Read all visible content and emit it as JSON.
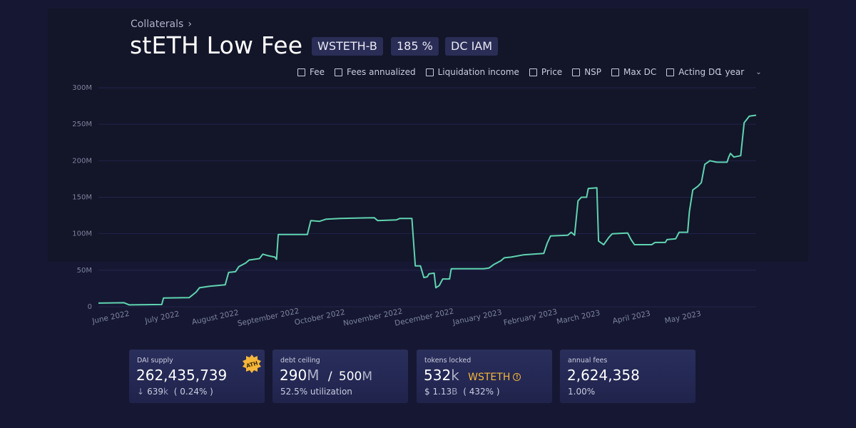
{
  "header": {
    "breadcrumb": "Collaterals",
    "title": "stETH Low Fee",
    "tags": [
      "WSTETH-B",
      "185 %",
      "DC IAM"
    ]
  },
  "toggles": [
    "Fee",
    "Fees annualized",
    "Liquidation income",
    "Price",
    "NSP",
    "Max DC",
    "Acting DC"
  ],
  "range": "1 year",
  "chart_data": {
    "type": "line",
    "title": "",
    "xlabel": "",
    "ylabel": "",
    "y_ticks": [
      "0",
      "50M",
      "100M",
      "150M",
      "200M",
      "250M",
      "300M"
    ],
    "ylim": [
      0,
      300000000
    ],
    "x_ticks": [
      "June 2022",
      "July 2022",
      "August 2022",
      "September 2022",
      "October 2022",
      "November 2022",
      "December 2022",
      "January 2023",
      "February 2023",
      "March 2023",
      "April 2023",
      "May 2023"
    ],
    "xlim": [
      "2022-06-01",
      "2023-06-08"
    ],
    "grid": true,
    "line_color": "#5fd4b0",
    "series": [
      {
        "name": "DAI supply",
        "points": [
          [
            "2022-06-01",
            5
          ],
          [
            "2022-06-16",
            5.5
          ],
          [
            "2022-06-19",
            2.5
          ],
          [
            "2022-07-08",
            3
          ],
          [
            "2022-07-09",
            12
          ],
          [
            "2022-07-24",
            12.5
          ],
          [
            "2022-07-28",
            20
          ],
          [
            "2022-07-30",
            26
          ],
          [
            "2022-08-05",
            28
          ],
          [
            "2022-08-14",
            30
          ],
          [
            "2022-08-16",
            47
          ],
          [
            "2022-08-20",
            48
          ],
          [
            "2022-08-22",
            55
          ],
          [
            "2022-08-26",
            60
          ],
          [
            "2022-08-28",
            64
          ],
          [
            "2022-09-03",
            66
          ],
          [
            "2022-09-05",
            72
          ],
          [
            "2022-09-08",
            70
          ],
          [
            "2022-09-12",
            68
          ],
          [
            "2022-09-13",
            65
          ],
          [
            "2022-09-14",
            99
          ],
          [
            "2022-10-01",
            99
          ],
          [
            "2022-10-03",
            118
          ],
          [
            "2022-10-08",
            117
          ],
          [
            "2022-10-12",
            120
          ],
          [
            "2022-10-20",
            121
          ],
          [
            "2022-11-09",
            122
          ],
          [
            "2022-11-11",
            118
          ],
          [
            "2022-11-22",
            119
          ],
          [
            "2022-11-24",
            121
          ],
          [
            "2022-12-01",
            121
          ],
          [
            "2022-12-03",
            56
          ],
          [
            "2022-12-06",
            56
          ],
          [
            "2022-12-08",
            40
          ],
          [
            "2022-12-10",
            41
          ],
          [
            "2022-12-11",
            45
          ],
          [
            "2022-12-14",
            46
          ],
          [
            "2022-12-15",
            26
          ],
          [
            "2022-12-17",
            29
          ],
          [
            "2022-12-19",
            38
          ],
          [
            "2022-12-23",
            38
          ],
          [
            "2022-12-24",
            52
          ],
          [
            "2023-01-12",
            52
          ],
          [
            "2023-01-15",
            53
          ],
          [
            "2023-01-18",
            58
          ],
          [
            "2023-01-22",
            63
          ],
          [
            "2023-01-24",
            67
          ],
          [
            "2023-01-28",
            68
          ],
          [
            "2023-02-04",
            71
          ],
          [
            "2023-02-16",
            73
          ],
          [
            "2023-02-18",
            87
          ],
          [
            "2023-02-20",
            97
          ],
          [
            "2023-03-02",
            98
          ],
          [
            "2023-03-04",
            102
          ],
          [
            "2023-03-06",
            98
          ],
          [
            "2023-03-08",
            145
          ],
          [
            "2023-03-10",
            150
          ],
          [
            "2023-03-13",
            150
          ],
          [
            "2023-03-14",
            162
          ],
          [
            "2023-03-19",
            163
          ],
          [
            "2023-03-20",
            90
          ],
          [
            "2023-03-23",
            85
          ],
          [
            "2023-03-26",
            95
          ],
          [
            "2023-03-28",
            100
          ],
          [
            "2023-04-06",
            101
          ],
          [
            "2023-04-08",
            92
          ],
          [
            "2023-04-10",
            85
          ],
          [
            "2023-04-20",
            85
          ],
          [
            "2023-04-22",
            88
          ],
          [
            "2023-04-28",
            88
          ],
          [
            "2023-04-29",
            92
          ],
          [
            "2023-05-04",
            93
          ],
          [
            "2023-05-06",
            102
          ],
          [
            "2023-05-11",
            102
          ],
          [
            "2023-05-12",
            130
          ],
          [
            "2023-05-14",
            160
          ],
          [
            "2023-05-17",
            165
          ],
          [
            "2023-05-19",
            170
          ],
          [
            "2023-05-21",
            195
          ],
          [
            "2023-05-24",
            200
          ],
          [
            "2023-05-28",
            198
          ],
          [
            "2023-06-03",
            198
          ],
          [
            "2023-06-04",
            205
          ],
          [
            "2023-06-05",
            210
          ],
          [
            "2023-06-07",
            205
          ],
          [
            "2023-06-11",
            207
          ],
          [
            "2023-06-13",
            252
          ],
          [
            "2023-06-16",
            261
          ],
          [
            "2023-06-20",
            262.4
          ]
        ],
        "unit": "M"
      }
    ]
  },
  "cards": [
    {
      "label": "DAI supply",
      "value": "262,435,739",
      "sub_value": "639",
      "sub_unit": "k",
      "sub_pct": "( 0.24% )",
      "badge": "ATH"
    },
    {
      "label": "debt ceiling",
      "value_main": "290",
      "value_unit": "M",
      "sep": "/",
      "value_max": "500",
      "value_max_unit": "M",
      "sub": "52.5% utilization"
    },
    {
      "label": "tokens locked",
      "value_main": "532",
      "value_unit": "k",
      "token": "WSTETH",
      "sub_prefix": "$ 1.13",
      "sub_unit": "B",
      "sub_pct": "( 432% )"
    },
    {
      "label": "annual fees",
      "value": "2,624,358",
      "sub": "1.00%"
    }
  ],
  "colors": {
    "background": "#161833",
    "panel": "#131529",
    "line": "#5fd4b0",
    "accent_gold": "#f5b63a",
    "tag_bg": "#2a2d55"
  }
}
